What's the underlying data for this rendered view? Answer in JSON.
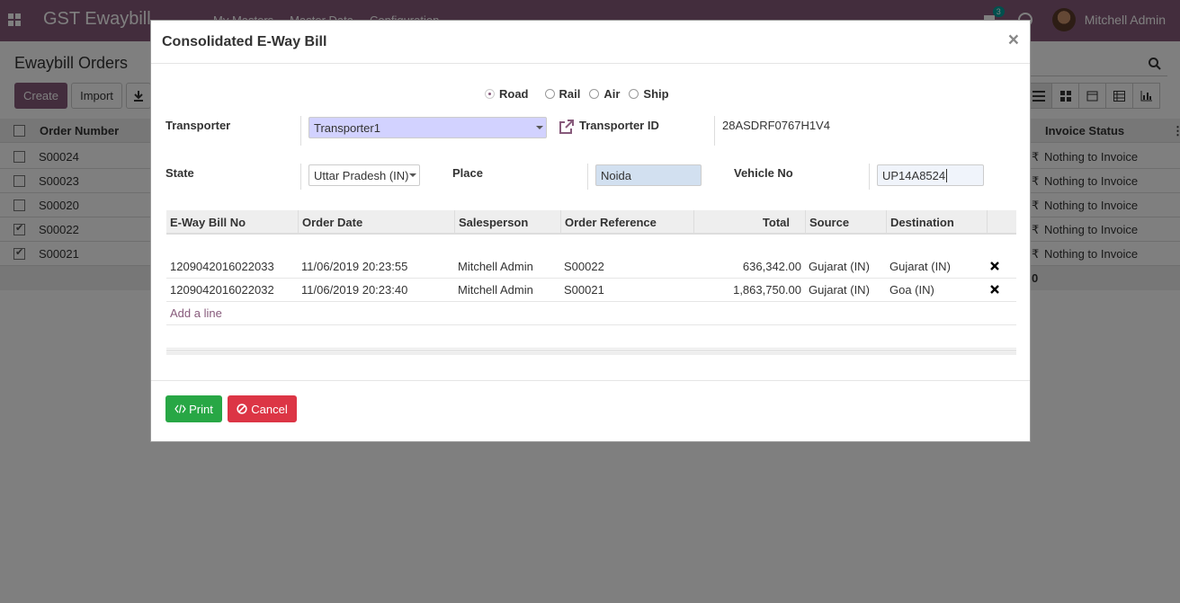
{
  "app": {
    "brand": "GST Ewaybill",
    "menu": [
      "My Masters",
      "Master Data",
      "Configuration"
    ],
    "chat_count": "3",
    "user": "Mitchell Admin"
  },
  "control_panel": {
    "title": "Ewaybill Orders",
    "create_label": "Create",
    "import_label": "Import"
  },
  "list": {
    "headers": [
      "Order Number",
      "Invoice Status"
    ],
    "rows": [
      {
        "order": "S00024",
        "checked": false,
        "currency": "₹",
        "invoice_status": "Nothing to Invoice"
      },
      {
        "order": "S00023",
        "checked": false,
        "currency": "₹",
        "invoice_status": "Nothing to Invoice"
      },
      {
        "order": "S00020",
        "checked": false,
        "currency": "₹",
        "invoice_status": "Nothing to Invoice"
      },
      {
        "order": "S00022",
        "checked": true,
        "currency": "₹",
        "invoice_status": "Nothing to Invoice"
      },
      {
        "order": "S00021",
        "checked": true,
        "currency": "₹",
        "invoice_status": "Nothing to Invoice"
      }
    ],
    "footer_total": "0"
  },
  "modal": {
    "title": "Consolidated E-Way Bill",
    "close": "×",
    "modes": [
      {
        "label": "Road",
        "selected": true
      },
      {
        "label": "Rail",
        "selected": false
      },
      {
        "label": "Air",
        "selected": false
      },
      {
        "label": "Ship",
        "selected": false
      }
    ],
    "transporter_label": "Transporter",
    "transporter_value": "Transporter1",
    "transporter_id_label": "Transporter ID",
    "transporter_id_value": "28ASDRF0767H1V4",
    "state_label": "State",
    "state_value": "Uttar Pradesh (IN)",
    "place_label": "Place",
    "place_value": "Noida",
    "vehicle_label": "Vehicle No",
    "vehicle_value": "UP14A8524",
    "table": {
      "headers": [
        "E-Way Bill No",
        "Order Date",
        "Salesperson",
        "Order Reference",
        "Total",
        "Source",
        "Destination"
      ],
      "rows": [
        [
          "1209042016022033",
          "11/06/2019 20:23:55",
          "Mitchell Admin",
          "S00022",
          "636,342.00",
          "Gujarat (IN)",
          "Gujarat (IN)"
        ],
        [
          "1209042016022032",
          "11/06/2019 20:23:40",
          "Mitchell Admin",
          "S00021",
          "1,863,750.00",
          "Gujarat (IN)",
          "Goa (IN)"
        ]
      ],
      "add_line": "Add a line"
    },
    "print_label": "Print",
    "cancel_label": "Cancel"
  },
  "colors": {
    "brand": "#875a7b",
    "print": "#28a745",
    "cancel": "#dc3545"
  }
}
